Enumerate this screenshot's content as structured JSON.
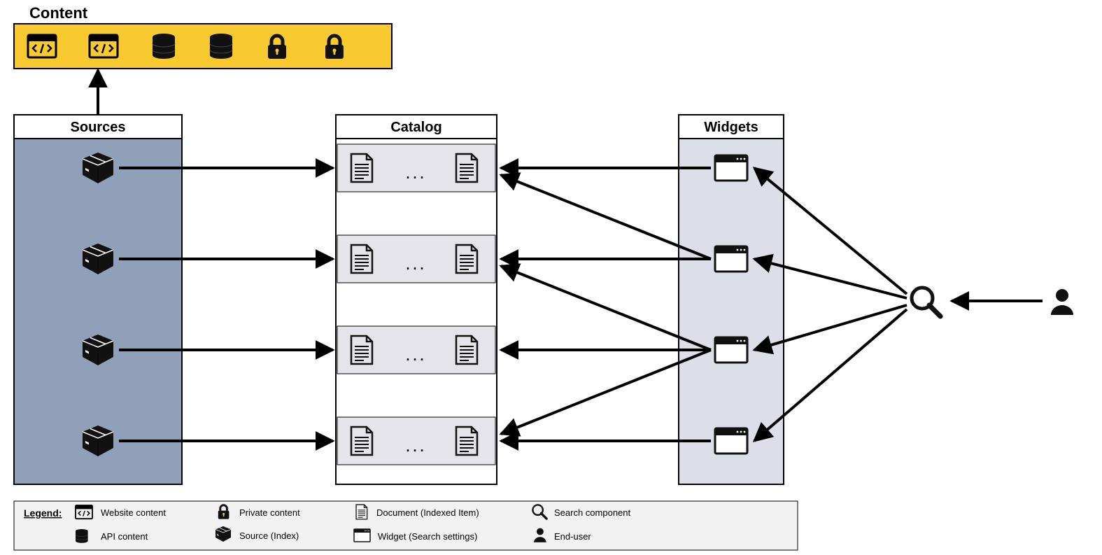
{
  "titles": {
    "content": "Content",
    "sources": "Sources",
    "catalog": "Catalog",
    "widgets": "Widgets"
  },
  "catalog": {
    "ellipsis": ". . ."
  },
  "legend": {
    "heading": "Legend:",
    "items": {
      "website": "Website content",
      "private": "Private content",
      "document": "Document (Indexed Item)",
      "search": "Search component",
      "api": "API content",
      "source": "Source (Index)",
      "widget": "Widget (Search settings)",
      "user": "End-user"
    }
  },
  "colors": {
    "contentFill": "#F9C930",
    "sourcesFill": "#8FA0B8",
    "catalogRowFill": "#E4E4EA",
    "widgetsFill": "#DCDEE8",
    "legendFill": "#F2F2F2",
    "stroke": "#000000"
  }
}
